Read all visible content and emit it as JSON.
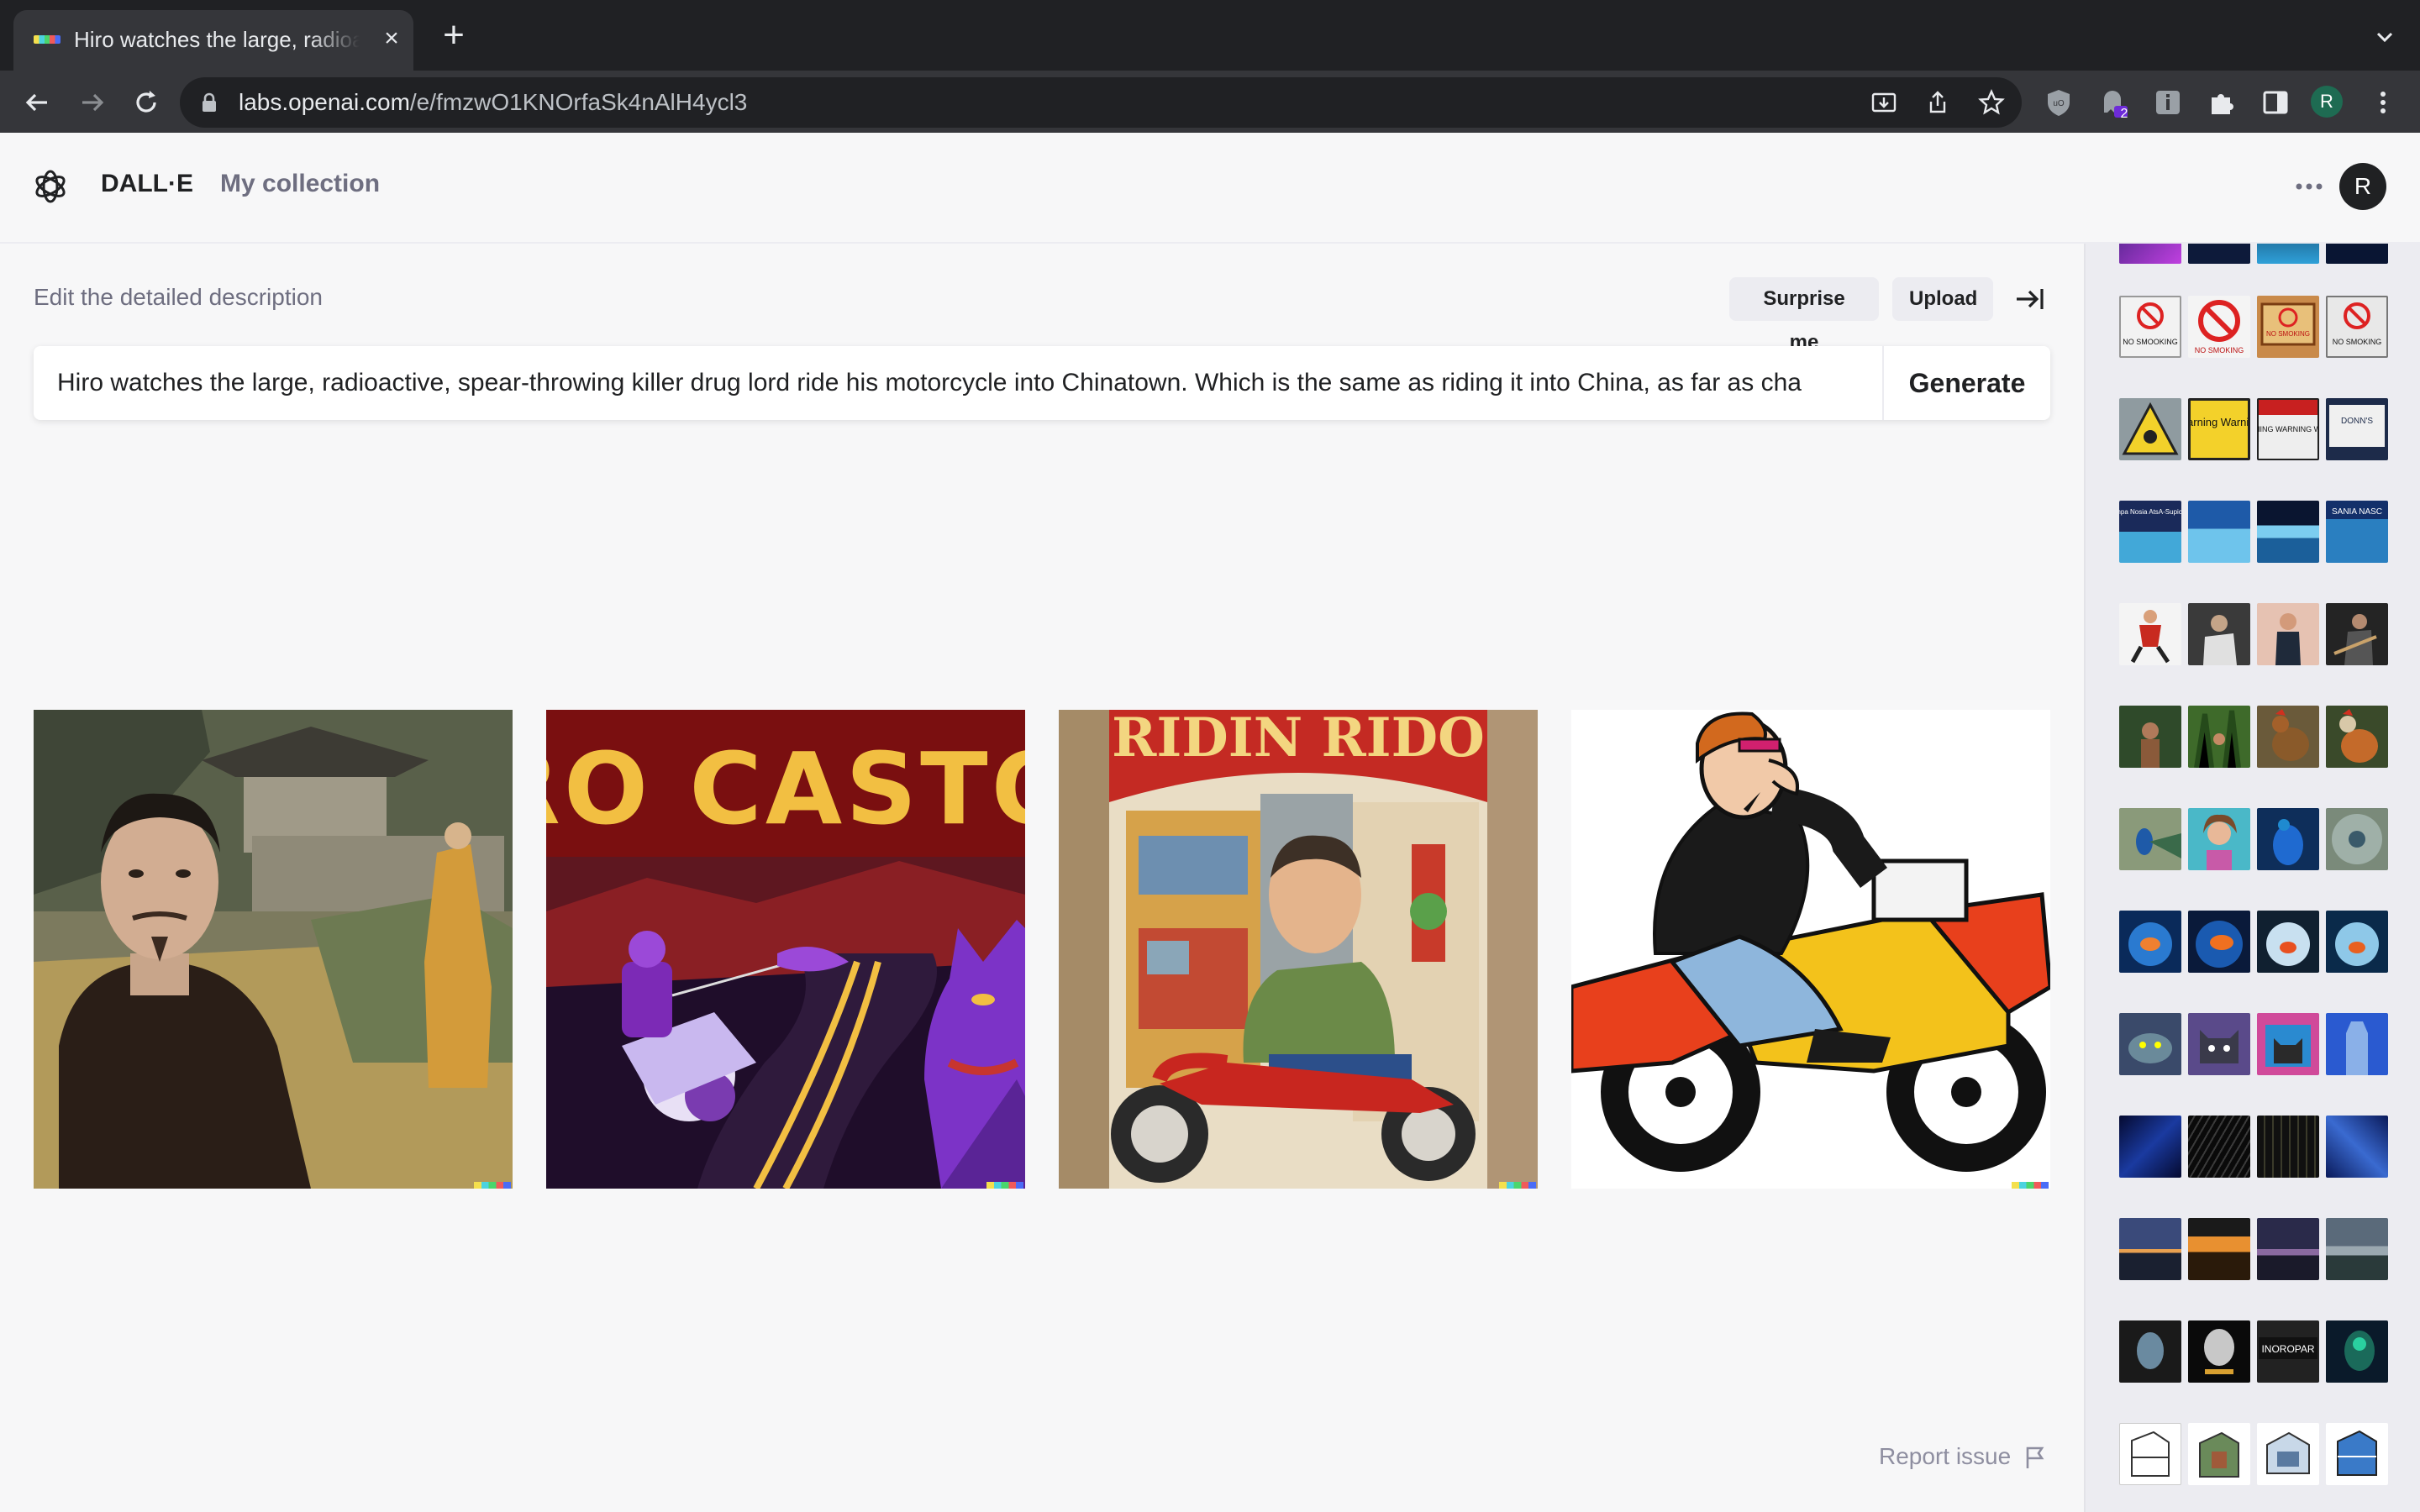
{
  "browser": {
    "tab_title": "Hiro watches the large, radioactive",
    "tab_close": "×",
    "new_tab": "+",
    "url_host": "labs.openai.com",
    "url_path": "/e/fmzwO1KNOrfaSk4nAlH4ycl3",
    "extension_badge": "2",
    "profile_initial": "R"
  },
  "app": {
    "brand": "DALL·E",
    "nav_collection": "My collection",
    "user_initial": "R"
  },
  "editor": {
    "label": "Edit the detailed description",
    "surprise_label": "Surprise me",
    "upload_label": "Upload",
    "prompt_value": "Hiro watches the large, radioactive, spear-throwing killer drug lord ride his motorcycle into Chinatown. Which is the same as riding it into China, as far as cha",
    "generate_label": "Generate"
  },
  "images": {
    "img2_title": "RO CASTO",
    "img3_sign": "RIDIN RIDO"
  },
  "footer": {
    "report_label": "Report issue"
  },
  "sidebar_history": {
    "row1": [
      "NO SMOOKING",
      "NO SMOKING",
      "NO SMOKING",
      "NO SMOKING"
    ],
    "row2": [
      "",
      "Warning Warning",
      "WANING WARNING WIRE",
      "DONN'S"
    ],
    "row3": [
      "Impa Nosia AtsA-Supicia",
      "",
      "",
      "SANIA NASC"
    ],
    "row_last": [
      "",
      "",
      "",
      "INOROPAR"
    ]
  },
  "colors": {
    "accent_dark": "#202123",
    "muted_text": "#6e6e80",
    "page_bg": "#f7f7f8",
    "browser_frame": "#202124"
  }
}
